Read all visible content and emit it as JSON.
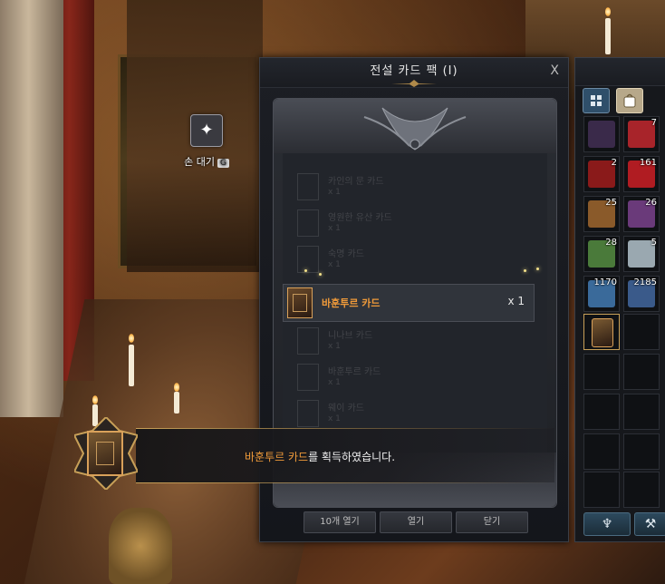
{
  "hand_standby": {
    "label": "손 대기",
    "key": "G",
    "icon": "sparkle-icon"
  },
  "card_pack_dialog": {
    "title": "전설 카드 팩 (I)",
    "close_label": "X",
    "faded_cards": [
      {
        "name": "카인의 문 카드",
        "qty": "x 1"
      },
      {
        "name": "영원한 유산 카드",
        "qty": "x 1"
      },
      {
        "name": "숙명 카드",
        "qty": "x 1"
      },
      {
        "name": "니나브 카드",
        "qty": "x 1"
      },
      {
        "name": "바훈투르 카드",
        "qty": "x 1"
      },
      {
        "name": "웨이 카드",
        "qty": "x 1"
      }
    ],
    "obtained_card": {
      "name": "바훈투르 카드",
      "qty": "x 1"
    },
    "buttons": {
      "open_ten": "10개 열기",
      "open": "열기",
      "close": "닫기"
    }
  },
  "acquisition_banner": {
    "card_name": "바훈투르 카드",
    "message_suffix": "를 획득하였습니다."
  },
  "inventory": {
    "tabs": [
      "grid-icon",
      "bag-icon"
    ],
    "slots": [
      {
        "count": "",
        "color": "#3a2a4a"
      },
      {
        "count": "7",
        "color": "#a8242a"
      },
      {
        "count": "2",
        "color": "#8a1a1a"
      },
      {
        "count": "161",
        "color": "#b01c22"
      },
      {
        "count": "25",
        "color": "#8a5a2a"
      },
      {
        "count": "26",
        "color": "#6a3a7a"
      },
      {
        "count": "28",
        "color": "#4a7a3a"
      },
      {
        "count": "5",
        "color": "#9aa8b0"
      },
      {
        "count": "1170",
        "color": "#3a6a9a"
      },
      {
        "count": "2185",
        "color": "#3a5a8a"
      },
      {
        "count": "",
        "color": "#5a3a20"
      }
    ],
    "bottom_buttons": [
      "trident-icon",
      "hammer-icon"
    ]
  },
  "colors": {
    "highlight_orange": "#ef9a3a",
    "dialog_bg": "#1c1e24",
    "gold_border": "#d9a15a"
  }
}
